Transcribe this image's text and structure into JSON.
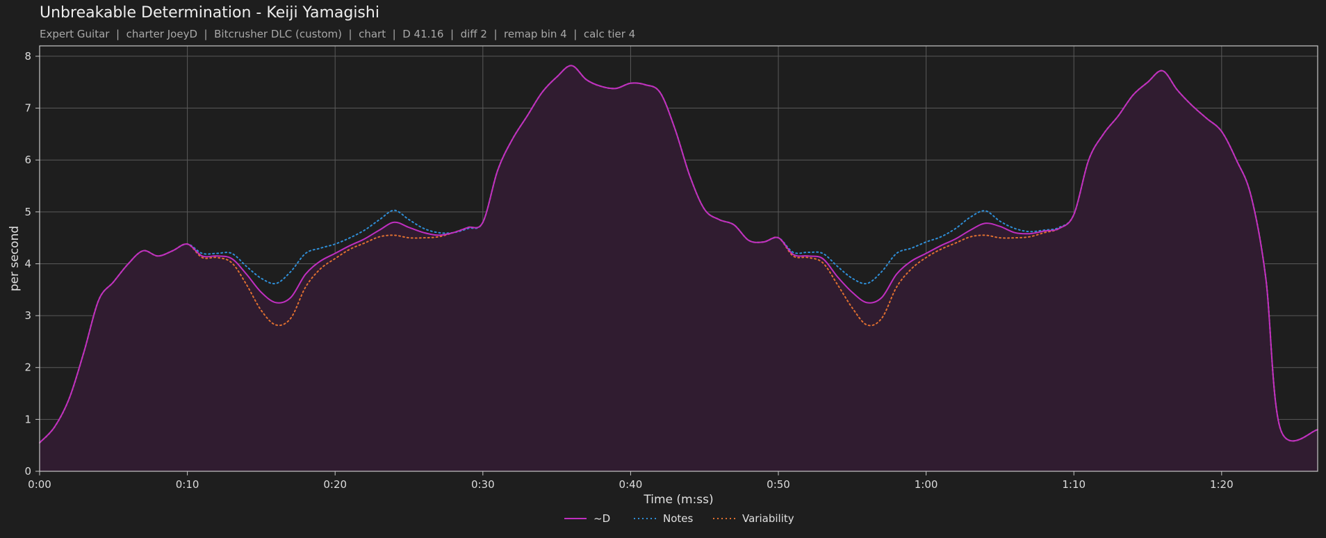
{
  "header": {
    "title": "Unbreakable Determination - Keiji Yamagishi",
    "subtitle": "Expert Guitar  |  charter JoeyD  |  Bitcrusher DLC (custom)  |  chart  |  D 41.16  |  diff 2  |  remap bin 4  |  calc tier 4"
  },
  "colors": {
    "background": "#1e1e1e",
    "d_line": "#c02fc0",
    "notes_line": "#2f8fd8",
    "variability_line": "#e07030",
    "fill": "#301c30",
    "grid": "#5a5a5a",
    "axes": "#c8c8c8"
  },
  "chart_data": {
    "type": "line",
    "xlabel": "Time (m:ss)",
    "ylabel": "per second",
    "xlim": [
      0,
      86.5
    ],
    "ylim": [
      0,
      8.2
    ],
    "grid": true,
    "legend_position": "bottom-center",
    "x_ticks": [
      {
        "value": 0,
        "label": "0:00"
      },
      {
        "value": 10,
        "label": "0:10"
      },
      {
        "value": 20,
        "label": "0:20"
      },
      {
        "value": 30,
        "label": "0:30"
      },
      {
        "value": 40,
        "label": "0:40"
      },
      {
        "value": 50,
        "label": "0:50"
      },
      {
        "value": 60,
        "label": "1:00"
      },
      {
        "value": 70,
        "label": "1:10"
      },
      {
        "value": 80,
        "label": "1:20"
      }
    ],
    "y_ticks": [
      {
        "value": 0,
        "label": "0"
      },
      {
        "value": 1,
        "label": "1"
      },
      {
        "value": 2,
        "label": "2"
      },
      {
        "value": 3,
        "label": "3"
      },
      {
        "value": 4,
        "label": "4"
      },
      {
        "value": 5,
        "label": "5"
      },
      {
        "value": 6,
        "label": "6"
      },
      {
        "value": 7,
        "label": "7"
      },
      {
        "value": 8,
        "label": "8"
      }
    ],
    "x": [
      0,
      1,
      2,
      3,
      4,
      5,
      6,
      7,
      8,
      9,
      10,
      11,
      12,
      13,
      14,
      15,
      16,
      17,
      18,
      19,
      20,
      21,
      22,
      23,
      24,
      25,
      26,
      27,
      28,
      29,
      30,
      31,
      32,
      33,
      34,
      35,
      36,
      37,
      38,
      39,
      40,
      41,
      42,
      43,
      44,
      45,
      46,
      47,
      48,
      49,
      50,
      51,
      52,
      53,
      54,
      55,
      56,
      57,
      58,
      59,
      60,
      61,
      62,
      63,
      64,
      65,
      66,
      67,
      68,
      69,
      70,
      71,
      72,
      73,
      74,
      75,
      76,
      77,
      78,
      79,
      80,
      81,
      82,
      83,
      84,
      85,
      86,
      86.5
    ],
    "series": [
      {
        "name": "~D",
        "style": "solid",
        "values": [
          0.55,
          0.85,
          1.4,
          2.3,
          3.3,
          3.65,
          4.0,
          4.25,
          4.15,
          4.25,
          4.38,
          4.15,
          4.15,
          4.1,
          3.8,
          3.45,
          3.25,
          3.35,
          3.8,
          4.05,
          4.2,
          4.35,
          4.48,
          4.65,
          4.8,
          4.7,
          4.6,
          4.55,
          4.6,
          4.7,
          4.8,
          5.8,
          6.4,
          6.85,
          7.3,
          7.6,
          7.82,
          7.55,
          7.42,
          7.38,
          7.48,
          7.45,
          7.3,
          6.6,
          5.7,
          5.05,
          4.85,
          4.75,
          4.45,
          4.42,
          4.5,
          4.18,
          4.15,
          4.1,
          3.75,
          3.45,
          3.25,
          3.35,
          3.8,
          4.05,
          4.2,
          4.35,
          4.48,
          4.65,
          4.78,
          4.72,
          4.6,
          4.58,
          4.63,
          4.68,
          4.95,
          6.0,
          6.5,
          6.85,
          7.25,
          7.5,
          7.72,
          7.35,
          7.05,
          6.8,
          6.55,
          6.0,
          5.3,
          3.7,
          0.8
        ],
        "tail_note": "values trimmed to x grid; last two x use values 3.7 and 0.8"
      },
      {
        "name": "Notes",
        "style": "dotted",
        "values": [
          0.55,
          0.85,
          1.4,
          2.3,
          3.3,
          3.65,
          4.0,
          4.25,
          4.15,
          4.25,
          4.38,
          4.2,
          4.2,
          4.2,
          3.95,
          3.72,
          3.62,
          3.85,
          4.2,
          4.3,
          4.38,
          4.5,
          4.65,
          4.85,
          5.03,
          4.85,
          4.68,
          4.6,
          4.6,
          4.68,
          4.8,
          5.8,
          6.4,
          6.85,
          7.3,
          7.6,
          7.82,
          7.55,
          7.42,
          7.38,
          7.48,
          7.45,
          7.3,
          6.6,
          5.7,
          5.05,
          4.85,
          4.75,
          4.45,
          4.42,
          4.5,
          4.22,
          4.22,
          4.2,
          3.95,
          3.72,
          3.62,
          3.85,
          4.2,
          4.3,
          4.42,
          4.52,
          4.68,
          4.9,
          5.02,
          4.82,
          4.68,
          4.62,
          4.65,
          4.7,
          4.95,
          6.0,
          6.5,
          6.85,
          7.25,
          7.5,
          7.72,
          7.35,
          7.05,
          6.8,
          6.55,
          6.0,
          5.3,
          3.7,
          0.8
        ]
      },
      {
        "name": "Variability",
        "style": "dotted",
        "values": [
          0.55,
          0.85,
          1.4,
          2.3,
          3.3,
          3.65,
          4.0,
          4.25,
          4.15,
          4.25,
          4.38,
          4.12,
          4.12,
          4.02,
          3.6,
          3.1,
          2.82,
          2.95,
          3.55,
          3.9,
          4.1,
          4.28,
          4.4,
          4.52,
          4.55,
          4.5,
          4.5,
          4.52,
          4.6,
          4.7,
          4.8,
          5.8,
          6.4,
          6.85,
          7.3,
          7.6,
          7.82,
          7.55,
          7.42,
          7.38,
          7.48,
          7.45,
          7.3,
          6.6,
          5.7,
          5.05,
          4.85,
          4.75,
          4.45,
          4.42,
          4.5,
          4.15,
          4.12,
          4.02,
          3.6,
          3.15,
          2.82,
          2.95,
          3.55,
          3.9,
          4.12,
          4.28,
          4.4,
          4.52,
          4.55,
          4.5,
          4.5,
          4.52,
          4.6,
          4.68,
          4.95,
          6.0,
          6.5,
          6.85,
          7.25,
          7.5,
          7.72,
          7.35,
          7.05,
          6.8,
          6.55,
          6.0,
          5.3,
          3.7,
          0.8
        ]
      }
    ]
  }
}
